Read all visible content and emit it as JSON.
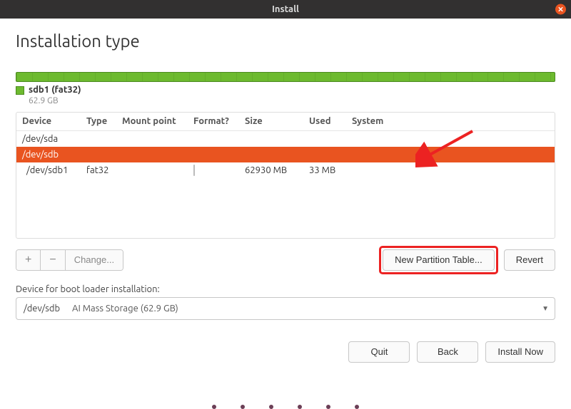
{
  "window": {
    "title": "Install"
  },
  "page": {
    "heading": "Installation type"
  },
  "legend": {
    "title": "sdb1 (fat32)",
    "size": "62.9 GB"
  },
  "columns": {
    "device": "Device",
    "type": "Type",
    "mount": "Mount point",
    "format": "Format?",
    "size": "Size",
    "used": "Used",
    "system": "System"
  },
  "rows": [
    {
      "device": "/dev/sda",
      "type": "",
      "mount": "",
      "format": "",
      "size": "",
      "used": "",
      "system": ""
    },
    {
      "device": "/dev/sdb",
      "type": "",
      "mount": "",
      "format": "",
      "size": "",
      "used": "",
      "system": ""
    },
    {
      "device": "/dev/sdb1",
      "type": "fat32",
      "mount": "",
      "format": "checkbox",
      "size": "62930 MB",
      "used": "33 MB",
      "system": ""
    }
  ],
  "toolbar": {
    "add": "+",
    "remove": "−",
    "change": "Change...",
    "new_table": "New Partition Table...",
    "revert": "Revert"
  },
  "bootloader": {
    "label": "Device for boot loader installation:",
    "device": "/dev/sdb",
    "desc": "AI Mass Storage (62.9 GB)"
  },
  "footer": {
    "quit": "Quit",
    "back": "Back",
    "install": "Install Now"
  }
}
